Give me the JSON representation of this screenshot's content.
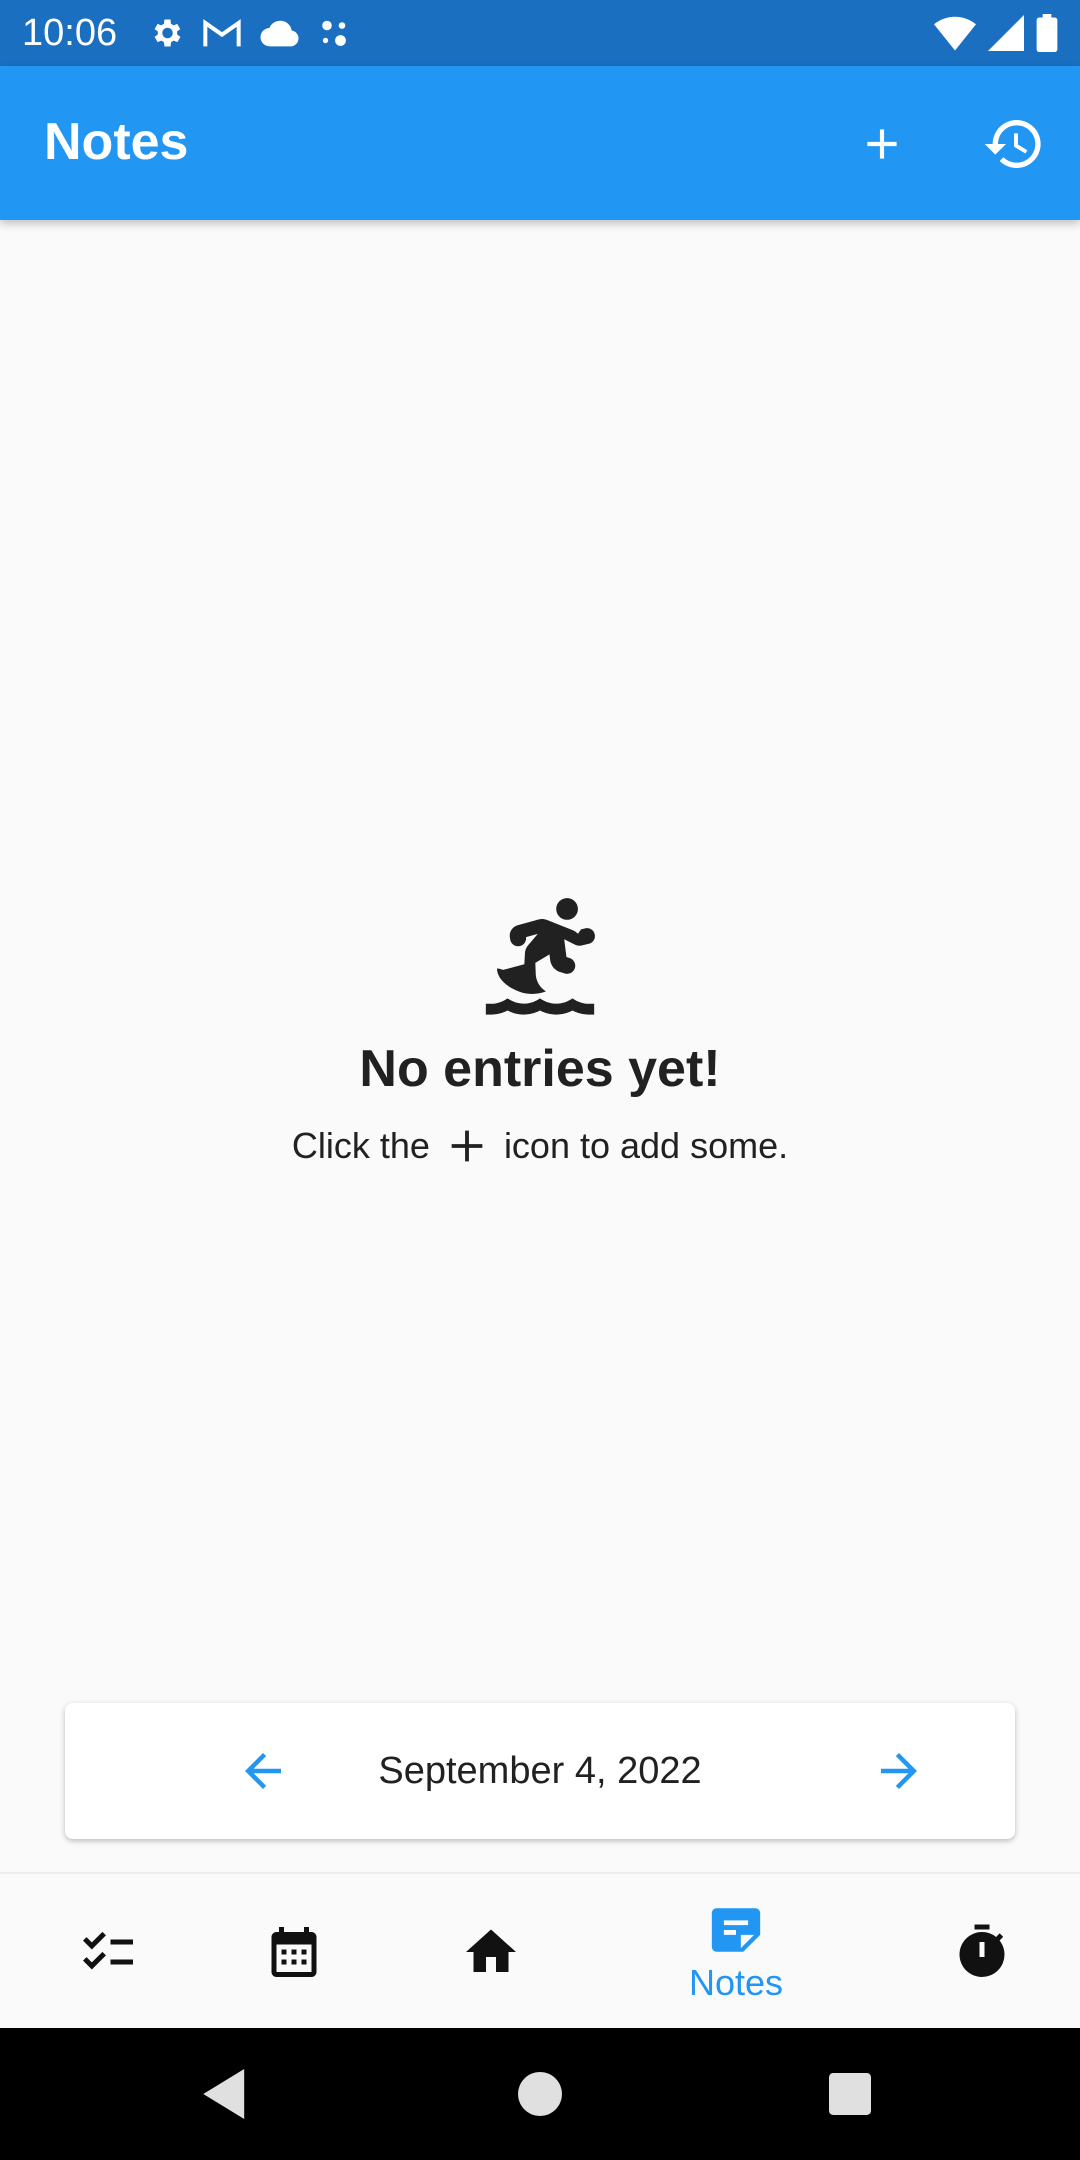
{
  "status_bar": {
    "time": "10:06",
    "left_icons": [
      "settings-icon",
      "gmail-icon",
      "cloud-icon",
      "assistant-dots-icon"
    ],
    "right_icons": [
      "wifi-icon",
      "cell-signal-icon",
      "battery-icon"
    ],
    "background_color": "#1a6fc0"
  },
  "app_bar": {
    "title": "Notes",
    "actions": [
      "add-icon",
      "history-icon"
    ],
    "background_color": "#2196f3"
  },
  "empty_state": {
    "icon": "surfing-icon",
    "title": "No entries yet!",
    "hint_before": "Click the",
    "hint_icon": "plus-icon",
    "hint_after": "icon to add some."
  },
  "date_navigator": {
    "date": "September 4, 2022",
    "prev_icon": "arrow-left-icon",
    "next_icon": "arrow-right-icon",
    "accent_color": "#2196f3"
  },
  "bottom_nav": {
    "items": [
      {
        "icon": "checklist-icon",
        "label": "",
        "active": false
      },
      {
        "icon": "calendar-icon",
        "label": "",
        "active": false
      },
      {
        "icon": "home-icon",
        "label": "",
        "active": false
      },
      {
        "icon": "notes-icon",
        "label": "Notes",
        "active": true
      },
      {
        "icon": "timer-icon",
        "label": "",
        "active": false
      }
    ],
    "active_color": "#2196f3"
  },
  "system_nav": {
    "buttons": [
      "back-icon",
      "home-circle-icon",
      "recents-icon"
    ]
  }
}
